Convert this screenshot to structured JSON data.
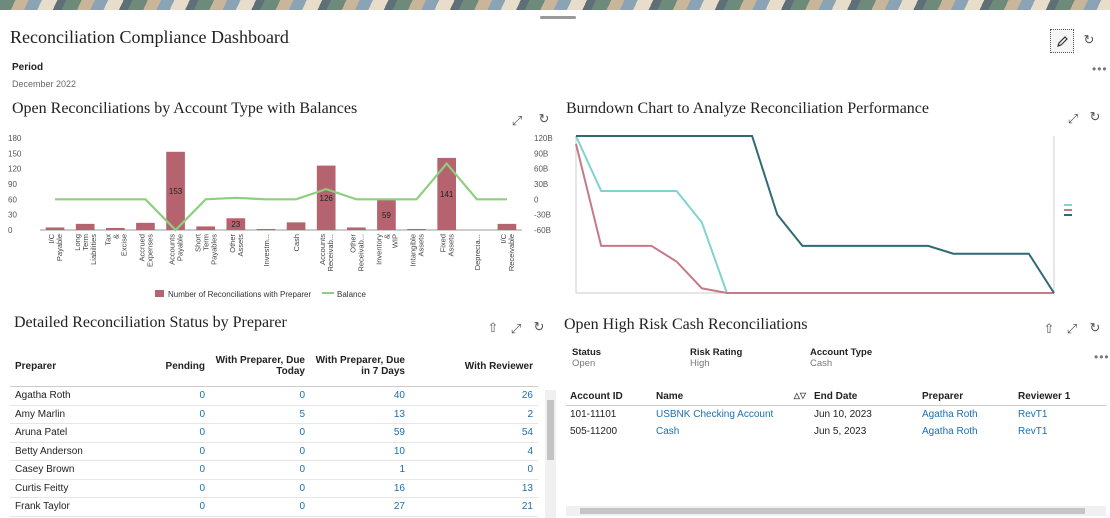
{
  "dashboard": {
    "title": "Reconciliation Compliance Dashboard",
    "period_label": "Period",
    "period_value": "December 2022"
  },
  "icons": {
    "edit": "pencil-icon",
    "refresh": "refresh-icon",
    "expand": "expand-icon",
    "export": "export-icon",
    "more": "more-icon",
    "sort": "sort-icon"
  },
  "panel1": {
    "title": "Open Reconciliations by Account Type with Balances",
    "legend_bar": "Number of Reconciliations with Preparer",
    "legend_line": "Balance"
  },
  "panel2": {
    "title": "Burndown Chart to Analyze Reconciliation Performance"
  },
  "panel3": {
    "title": "Detailed Reconciliation Status by Preparer",
    "columns": [
      "Preparer",
      "Pending",
      "With Preparer, Due Today",
      "With Preparer, Due in 7 Days",
      "With Reviewer"
    ],
    "rows": [
      [
        "Agatha Roth",
        "0",
        "0",
        "40",
        "26"
      ],
      [
        "Amy Marlin",
        "0",
        "5",
        "13",
        "2"
      ],
      [
        "Aruna Patel",
        "0",
        "0",
        "59",
        "54"
      ],
      [
        "Betty Anderson",
        "0",
        "0",
        "10",
        "4"
      ],
      [
        "Casey Brown",
        "0",
        "0",
        "1",
        "0"
      ],
      [
        "Curtis Feitty",
        "0",
        "0",
        "16",
        "13"
      ],
      [
        "Frank Taylor",
        "0",
        "0",
        "27",
        "21"
      ]
    ]
  },
  "panel4": {
    "title": "Open High Risk Cash Reconciliations",
    "filters": [
      {
        "label": "Status",
        "value": "Open"
      },
      {
        "label": "Risk Rating",
        "value": "High"
      },
      {
        "label": "Account Type",
        "value": "Cash"
      }
    ],
    "columns": [
      "Account ID",
      "Name",
      "End Date",
      "Preparer",
      "Reviewer 1"
    ],
    "rows": [
      [
        "101-11101",
        "USBNK Checking Account",
        "Jun 10, 2023",
        "Agatha Roth",
        "RevT1"
      ],
      [
        "505-11200",
        "Cash",
        "Jun 5, 2023",
        "Agatha Roth",
        "RevT1"
      ]
    ]
  },
  "colors": {
    "bar": "#b5646f",
    "line": "#8ccf7e",
    "teal": "#7fd4d0",
    "dark": "#2f6b73",
    "pink": "#c57a86",
    "link": "#1a6fb0"
  },
  "chart_data": [
    {
      "type": "bar",
      "categories": [
        "I/C Payable",
        "Long Term Liabilities",
        "Tax & Excise Duty",
        "Accrued Expenses",
        "Accounts Payable",
        "Short Term Payables",
        "Other Assets",
        "Investm...",
        "Cash",
        "Accounts Receivab...",
        "Other Receivab...",
        "Inventory & WIP",
        "Intangible Assets",
        "Fixed Assets",
        "Deprecia...",
        "I/C Receivable"
      ],
      "series": [
        {
          "name": "Number of Reconciliations with Preparer",
          "values": [
            5,
            12,
            4,
            14,
            153,
            7,
            23,
            2,
            15,
            126,
            5,
            59,
            2,
            141,
            0,
            12
          ],
          "axis": "left"
        },
        {
          "name": "Balance",
          "type": "line",
          "values": [
            0,
            0,
            0,
            0,
            -60,
            0,
            3,
            0,
            0,
            20,
            0,
            0,
            0,
            70,
            0,
            0
          ],
          "axis": "right"
        }
      ],
      "data_labels": {
        "4": "153",
        "6": "23",
        "9": "126",
        "11": "59",
        "13": "141"
      },
      "ylim": [
        0,
        180
      ],
      "yticks": [
        "180",
        "150",
        "120",
        "90",
        "60",
        "30",
        "0"
      ],
      "y2lim": [
        -60,
        120
      ],
      "y2ticks": [
        "120B",
        "90B",
        "60B",
        "30B",
        "0",
        "-30B",
        "-60B"
      ],
      "legend": "bottom"
    },
    {
      "type": "line",
      "x_count": 20,
      "series": [
        {
          "color": "teal",
          "values": [
            100,
            65,
            65,
            65,
            65,
            45,
            0,
            0,
            0,
            0,
            0,
            0,
            0,
            0,
            0,
            0,
            0,
            0,
            0,
            0
          ]
        },
        {
          "color": "pink",
          "values": [
            95,
            30,
            30,
            30,
            20,
            3,
            0,
            0,
            0,
            0,
            0,
            0,
            0,
            0,
            0,
            0,
            0,
            0,
            0,
            0
          ]
        },
        {
          "color": "dark",
          "values": [
            100,
            100,
            100,
            100,
            100,
            100,
            100,
            100,
            50,
            30,
            30,
            30,
            30,
            30,
            30,
            25,
            25,
            25,
            25,
            0
          ]
        }
      ],
      "ylim": [
        0,
        100
      ],
      "legend": "right"
    }
  ]
}
